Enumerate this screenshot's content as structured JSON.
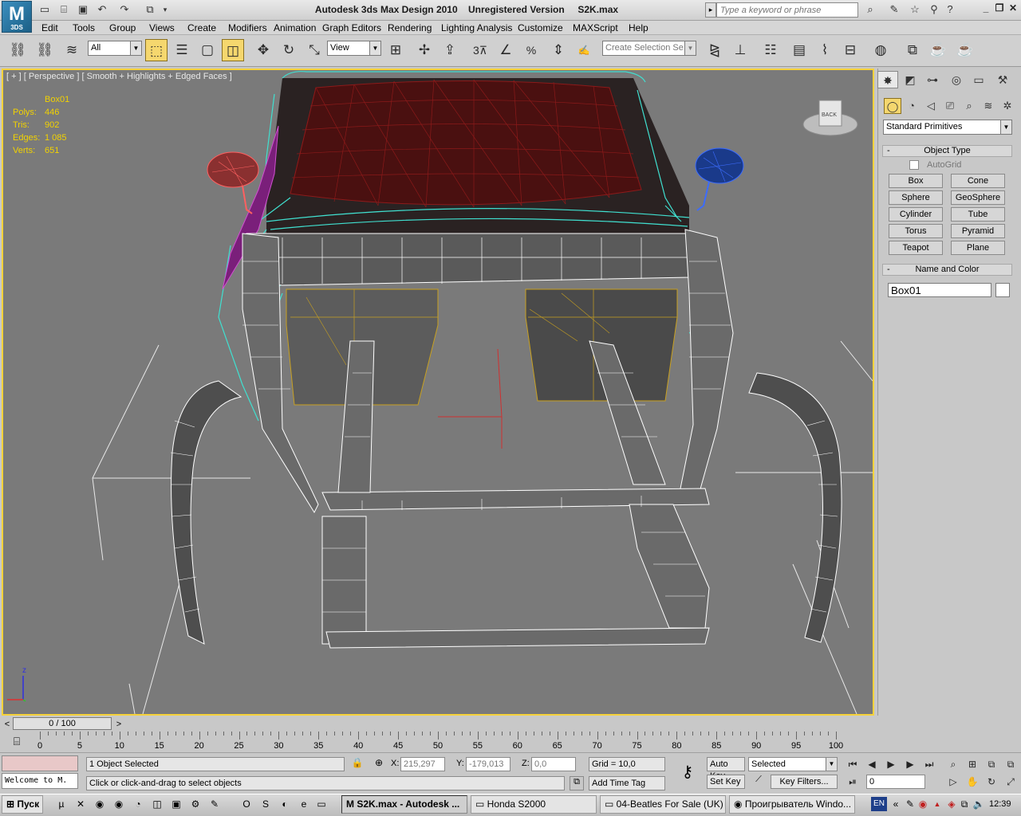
{
  "app": {
    "logo_main": "M",
    "logo_sub": "3DS",
    "title": "Autodesk 3ds Max Design 2010    Unregistered Version     S2K.max",
    "search_placeholder": "Type a keyword or phrase"
  },
  "menu": [
    "Edit",
    "Tools",
    "Group",
    "Views",
    "Create",
    "Modifiers",
    "Animation",
    "Graph Editors",
    "Rendering",
    "Lighting Analysis",
    "Customize",
    "MAXScript",
    "Help"
  ],
  "toolbar": {
    "selection_filter": "All",
    "ref_coord": "View",
    "named_selection_placeholder": "Create Selection Se",
    "snap_3": "3",
    "snap_percent": "%"
  },
  "viewport": {
    "label": "[ + ] [ Perspective ] [ Smooth + Highlights + Edged Faces ]",
    "stats": {
      "object": "Box01",
      "polys_label": "Polys:",
      "polys": "446",
      "tris_label": "Tris:",
      "tris": "902",
      "edges_label": "Edges:",
      "edges": "1 085",
      "verts_label": "Verts:",
      "verts": "651"
    },
    "viewcube_label": "BACK",
    "axis_z": "z"
  },
  "panel": {
    "category": "Standard Primitives",
    "object_type_header": "Object Type",
    "autogrid": "AutoGrid",
    "buttons": [
      "Box",
      "Cone",
      "Sphere",
      "GeoSphere",
      "Cylinder",
      "Tube",
      "Torus",
      "Pyramid",
      "Teapot",
      "Plane"
    ],
    "name_color_header": "Name and Color",
    "object_name": "Box01"
  },
  "timeline": {
    "slider": "0 / 100",
    "ticks": [
      "0",
      "5",
      "10",
      "15",
      "20",
      "25",
      "30",
      "35",
      "40",
      "45",
      "50",
      "55",
      "60",
      "65",
      "70",
      "75",
      "80",
      "85",
      "90",
      "95",
      "100"
    ]
  },
  "status": {
    "maxscript_listener": "Welcome to M.",
    "selection": "1 Object Selected",
    "prompt": "Click or click-and-drag to select objects",
    "x_label": "X:",
    "x": "215,297",
    "y_label": "Y:",
    "y": "-179,013",
    "z_label": "Z:",
    "z": "0,0",
    "grid": "Grid = 10,0",
    "add_time_tag": "Add Time Tag",
    "auto_key": "Auto Key",
    "set_key": "Set Key",
    "key_mode": "Selected",
    "key_filters": "Key Filters...",
    "frame": "0"
  },
  "taskbar": {
    "start": "Пуск",
    "tasks": [
      "S2K.max - Autodesk ...",
      "Honda S2000",
      "04-Beatles For Sale (UK) ...",
      "Проигрыватель Windo..."
    ],
    "lang": "EN",
    "clock": "12:39"
  }
}
